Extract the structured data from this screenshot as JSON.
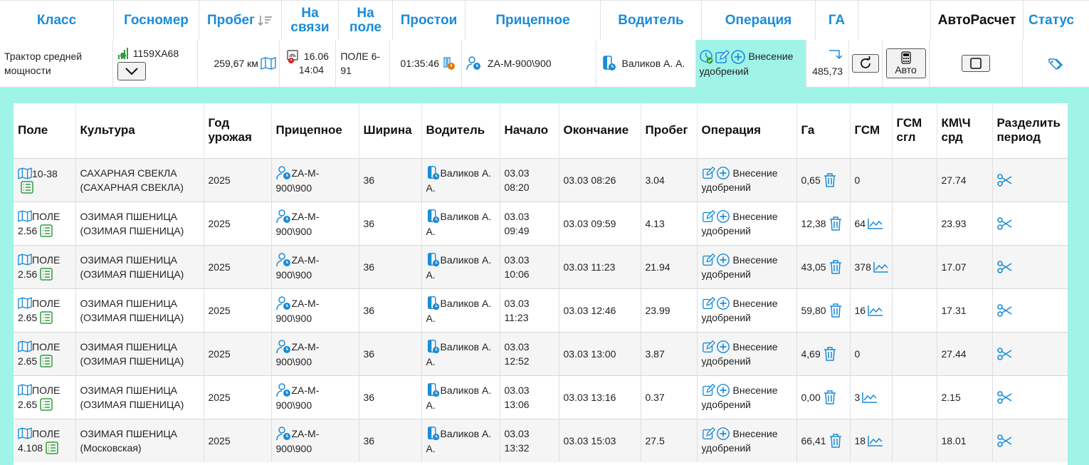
{
  "top_header": {
    "klass": "Класс",
    "gosnomer": "Госномер",
    "probeg": "Пробег",
    "na_svyazi": [
      "На",
      "связи"
    ],
    "na_pole": [
      "На",
      "поле"
    ],
    "prostoi": "Простои",
    "pritsepnoe": "Прицепное",
    "voditel": "Водитель",
    "operatsiya": "Операция",
    "ga": "ГА",
    "avtoraschet": "АвтоРасчет",
    "status": "Статус"
  },
  "vehicle": {
    "klass": [
      "Трактор средней",
      "мощности"
    ],
    "gosnomer": "1159ХА68",
    "probeg": "259,67 км",
    "svyaz_date": "16.06",
    "svyaz_time": "14:04",
    "pole": [
      "ПОЛЕ 6-",
      "91"
    ],
    "prostoi": "01:35:46",
    "pritsepnoe": "ZA-M-900\\900",
    "voditel": "Валиков А. А.",
    "operatsiya": [
      "Внесение",
      "удобрений"
    ],
    "ga": "485,73",
    "auto_button": "Авто"
  },
  "columns": {
    "pole": "Поле",
    "kultura": "Культура",
    "god": [
      "Год",
      "урожая"
    ],
    "pritsepnoe": "Прицепное",
    "shirina": "Ширина",
    "voditel": "Водитель",
    "nachalo": "Начало",
    "okonchanie": "Окончание",
    "probeg": "Пробег",
    "operatsiya": "Операция",
    "ga": "Га",
    "gsm": "ГСМ",
    "gsm_sgl": [
      "ГСМ",
      "сгл"
    ],
    "km_ch": [
      "КМ\\Ч",
      "срд"
    ],
    "razdelit": [
      "Разделить",
      "период"
    ]
  },
  "rows": [
    {
      "pole": [
        "10-38",
        ""
      ],
      "kultura": [
        "САХАРНАЯ СВЕКЛА",
        "(САХАРНАЯ СВЕКЛА)"
      ],
      "god": "2025",
      "pritsepnoe": [
        "ZA-M-",
        "900\\900"
      ],
      "shirina": "36",
      "voditel": [
        "Валиков А.",
        "А."
      ],
      "nachalo": [
        "03.03",
        "08:20"
      ],
      "okonchanie": "03.03 08:26",
      "probeg": "3.04",
      "operatsiya": [
        "Внесение",
        "удобрений"
      ],
      "ga": "0,65",
      "gsm": "0",
      "gsm_chart": false,
      "km_ch": "27.74"
    },
    {
      "pole": [
        "ПОЛЕ",
        "2.56"
      ],
      "kultura": [
        "ОЗИМАЯ ПШЕНИЦА",
        "(ОЗИМАЯ ПШЕНИЦА)"
      ],
      "god": "2025",
      "pritsepnoe": [
        "ZA-M-",
        "900\\900"
      ],
      "shirina": "36",
      "voditel": [
        "Валиков А.",
        "А."
      ],
      "nachalo": [
        "03.03",
        "09:49"
      ],
      "okonchanie": "03.03 09:59",
      "probeg": "4.13",
      "operatsiya": [
        "Внесение",
        "удобрений"
      ],
      "ga": "12,38",
      "gsm": "64",
      "gsm_chart": true,
      "km_ch": "23.93"
    },
    {
      "pole": [
        "ПОЛЕ",
        "2.56"
      ],
      "kultura": [
        "ОЗИМАЯ ПШЕНИЦА",
        "(ОЗИМАЯ ПШЕНИЦА)"
      ],
      "god": "2025",
      "pritsepnoe": [
        "ZA-M-",
        "900\\900"
      ],
      "shirina": "36",
      "voditel": [
        "Валиков А.",
        "А."
      ],
      "nachalo": [
        "03.03",
        "10:06"
      ],
      "okonchanie": "03.03 11:23",
      "probeg": "21.94",
      "operatsiya": [
        "Внесение",
        "удобрений"
      ],
      "ga": "43,05",
      "gsm": "378",
      "gsm_chart": true,
      "km_ch": "17.07"
    },
    {
      "pole": [
        "ПОЛЕ",
        "2.65"
      ],
      "kultura": [
        "ОЗИМАЯ ПШЕНИЦА",
        "(ОЗИМАЯ ПШЕНИЦА)"
      ],
      "god": "2025",
      "pritsepnoe": [
        "ZA-M-",
        "900\\900"
      ],
      "shirina": "36",
      "voditel": [
        "Валиков А.",
        "А."
      ],
      "nachalo": [
        "03.03",
        "11:23"
      ],
      "okonchanie": "03.03 12:46",
      "probeg": "23.99",
      "operatsiya": [
        "Внесение",
        "удобрений"
      ],
      "ga": "59,80",
      "gsm": "16",
      "gsm_chart": true,
      "km_ch": "17.31"
    },
    {
      "pole": [
        "ПОЛЕ",
        "2.65"
      ],
      "kultura": [
        "ОЗИМАЯ ПШЕНИЦА",
        "(ОЗИМАЯ ПШЕНИЦА)"
      ],
      "god": "2025",
      "pritsepnoe": [
        "ZA-M-",
        "900\\900"
      ],
      "shirina": "36",
      "voditel": [
        "Валиков А.",
        "А."
      ],
      "nachalo": [
        "03.03",
        "12:52"
      ],
      "okonchanie": "03.03 13:00",
      "probeg": "3.87",
      "operatsiya": [
        "Внесение",
        "удобрений"
      ],
      "ga": "4,69",
      "gsm": "0",
      "gsm_chart": false,
      "km_ch": "27.44"
    },
    {
      "pole": [
        "ПОЛЕ",
        "2.65"
      ],
      "kultura": [
        "ОЗИМАЯ ПШЕНИЦА",
        "(ОЗИМАЯ ПШЕНИЦА)"
      ],
      "god": "2025",
      "pritsepnoe": [
        "ZA-M-",
        "900\\900"
      ],
      "shirina": "36",
      "voditel": [
        "Валиков А.",
        "А."
      ],
      "nachalo": [
        "03.03",
        "13:06"
      ],
      "okonchanie": "03.03 13:16",
      "probeg": "0.37",
      "operatsiya": [
        "Внесение",
        "удобрений"
      ],
      "ga": "0,00",
      "gsm": "3",
      "gsm_chart": true,
      "km_ch": "2.15"
    },
    {
      "pole": [
        "ПОЛЕ",
        "4.108"
      ],
      "kultura": [
        "ОЗИМАЯ ПШЕНИЦА",
        "(Московская)"
      ],
      "god": "2025",
      "pritsepnoe": [
        "ZA-M-",
        "900\\900"
      ],
      "shirina": "36",
      "voditel": [
        "Валиков А.",
        "А."
      ],
      "nachalo": [
        "03.03",
        "13:32"
      ],
      "okonchanie": "03.03 15:03",
      "probeg": "27.5",
      "operatsiya": [
        "Внесение",
        "удобрений"
      ],
      "ga": "66,41",
      "gsm": "18",
      "gsm_chart": true,
      "km_ch": "18.01"
    }
  ],
  "colors": {
    "accent": "#1a8cd8",
    "teal": "#9ff3e7",
    "green": "#2e9e3e",
    "orange": "#e07b00",
    "red": "#e02020"
  }
}
